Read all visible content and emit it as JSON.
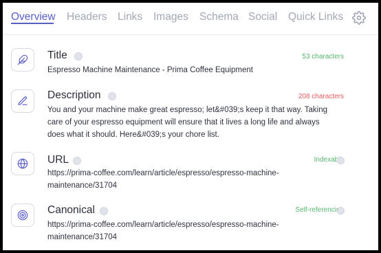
{
  "tabs": [
    {
      "label": "Overview"
    },
    {
      "label": "Headers"
    },
    {
      "label": "Links"
    },
    {
      "label": "Images"
    },
    {
      "label": "Schema"
    },
    {
      "label": "Social"
    },
    {
      "label": "Quick Links"
    }
  ],
  "active_tab": "Overview",
  "rows": [
    {
      "label": "Title",
      "value": "Espresso Machine Maintenance - Prima Coffee Equipment",
      "status": "53 characters",
      "status_color": "#56b56e",
      "icon": "feather-icon"
    },
    {
      "label": "Description",
      "value": "You and your machine make great espresso; let&#039;s keep it that way. Taking care of your espresso equipment will ensure that it lives a long life and always does what it should. Here&#039;s your chore list.",
      "status": "208 characters",
      "status_color": "#e45b5b",
      "icon": "pencil-icon"
    },
    {
      "label": "URL",
      "value": "https://prima-coffee.com/learn/article/espresso/espresso-machine-maintenance/31704",
      "status": "Indexable",
      "status_color": "#56b56e",
      "icon": "globe-icon"
    },
    {
      "label": "Canonical",
      "value": "https://prima-coffee.com/learn/article/espresso/espresso-machine-maintenance/31704",
      "status": "Self-referencing",
      "status_color": "#56b56e",
      "icon": "target-icon"
    }
  ],
  "colors": {
    "accent": "#5a5fc8",
    "tab_inactive": "#a3a7b6",
    "good": "#56b56e",
    "bad": "#e45b5b"
  },
  "icons": {
    "settings": "gear-icon",
    "info": "info-icon"
  }
}
